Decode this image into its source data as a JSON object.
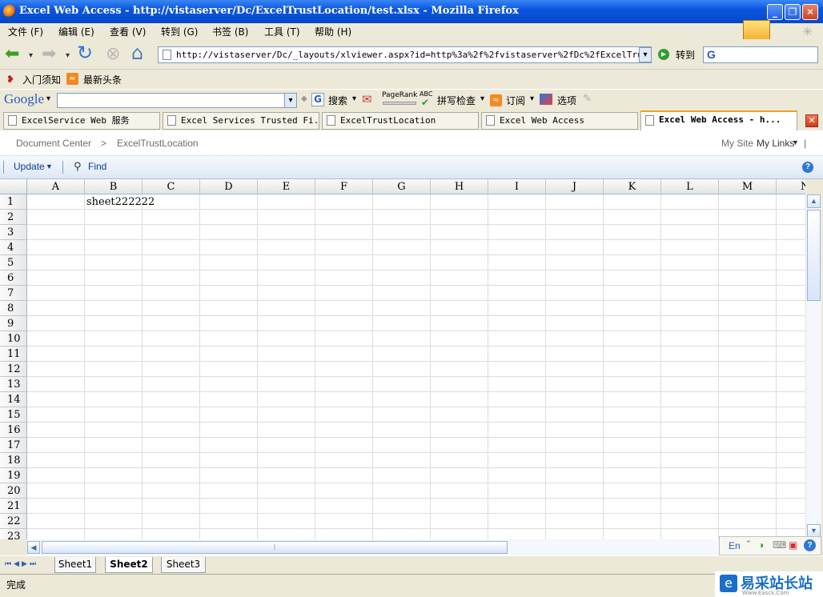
{
  "window": {
    "title": "Excel Web Access - http://vistaserver/Dc/ExcelTrustLocation/test.xlsx - Mozilla Firefox",
    "min": "_",
    "max": "❐",
    "close": "✕"
  },
  "menu": [
    "文件 (F)",
    "编辑 (E)",
    "查看 (V)",
    "转到 (G)",
    "书签 (B)",
    "工具 (T)",
    "帮助 (H)"
  ],
  "nav": {
    "url": "http://vistaserver/Dc/_layouts/xlviewer.aspx?id=http%3a%2f%2fvistaserver%2fDc%2fExcelTrustLocat",
    "go_label": "转到",
    "search_engine": "G"
  },
  "bookmarks": [
    "入门须知",
    "最新头条"
  ],
  "google_bar": {
    "logo": "Google",
    "search_label": "搜索",
    "pagerank": "PageRank",
    "abc": "ABC",
    "spell_label": "拼写检查",
    "subscribe_label": "订阅",
    "options_label": "选项"
  },
  "tabs": [
    {
      "label": "ExcelService Web 服务"
    },
    {
      "label": "Excel Services Trusted Fi..."
    },
    {
      "label": "ExcelTrustLocation"
    },
    {
      "label": "Excel Web Access"
    },
    {
      "label": "Excel Web Access - h..."
    }
  ],
  "breadcrumb": {
    "root": "Document Center",
    "sep": ">",
    "current": "ExcelTrustLocation"
  },
  "top_links": {
    "my_site": "My Site",
    "my_links": "My Links",
    "sep": "|"
  },
  "toolbar": {
    "update": "Update",
    "find": "Find",
    "help": "?"
  },
  "sheet": {
    "columns": [
      "A",
      "B",
      "C",
      "D",
      "E",
      "F",
      "G",
      "H",
      "I",
      "J",
      "K",
      "L",
      "M",
      "N"
    ],
    "rows": [
      "1",
      "2",
      "3",
      "4",
      "5",
      "6",
      "7",
      "8",
      "9",
      "10",
      "11",
      "12",
      "13",
      "14",
      "15",
      "16",
      "17",
      "18",
      "19",
      "20",
      "21",
      "22",
      "23"
    ],
    "cell_B1": "sheet222222"
  },
  "sheet_tabs": [
    {
      "label": "Sheet1",
      "active": false
    },
    {
      "label": "Sheet2",
      "active": true
    },
    {
      "label": "Sheet3",
      "active": false
    }
  ],
  "status": {
    "text": "完成",
    "ime": "En",
    "watermark": "易采站长站",
    "watermark_sub": "Www.Easck.Com"
  },
  "colors": {
    "titlebar": "#0a56e0",
    "accent": "#0c3d91",
    "grid": "#dadcdd"
  }
}
